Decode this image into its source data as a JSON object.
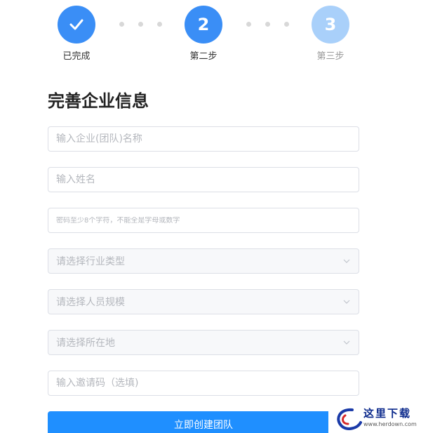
{
  "stepper": {
    "steps": [
      {
        "label": "已完成",
        "symbol": "✓"
      },
      {
        "label": "第二步",
        "symbol": "2"
      },
      {
        "label": "第三步",
        "symbol": "3"
      }
    ]
  },
  "form": {
    "title": "完善企业信息",
    "company_name": {
      "placeholder": "输入企业(团队)名称"
    },
    "full_name": {
      "placeholder": "输入姓名"
    },
    "password": {
      "placeholder": "密码至少8个字符，不能全是字母或数字"
    },
    "industry": {
      "placeholder": "请选择行业类型"
    },
    "staff_size": {
      "placeholder": "请选择人员规模"
    },
    "location": {
      "placeholder": "请选择所在地"
    },
    "invite_code": {
      "placeholder": "输入邀请码（选填)"
    },
    "submit_label": "立即创建团队"
  },
  "watermark": {
    "text": "这里下载",
    "url": "www.herdown.com"
  },
  "colors": {
    "primary": "#1f8fff",
    "step_active": "#3a8ef6",
    "step_pending": "#a9d0fa"
  }
}
